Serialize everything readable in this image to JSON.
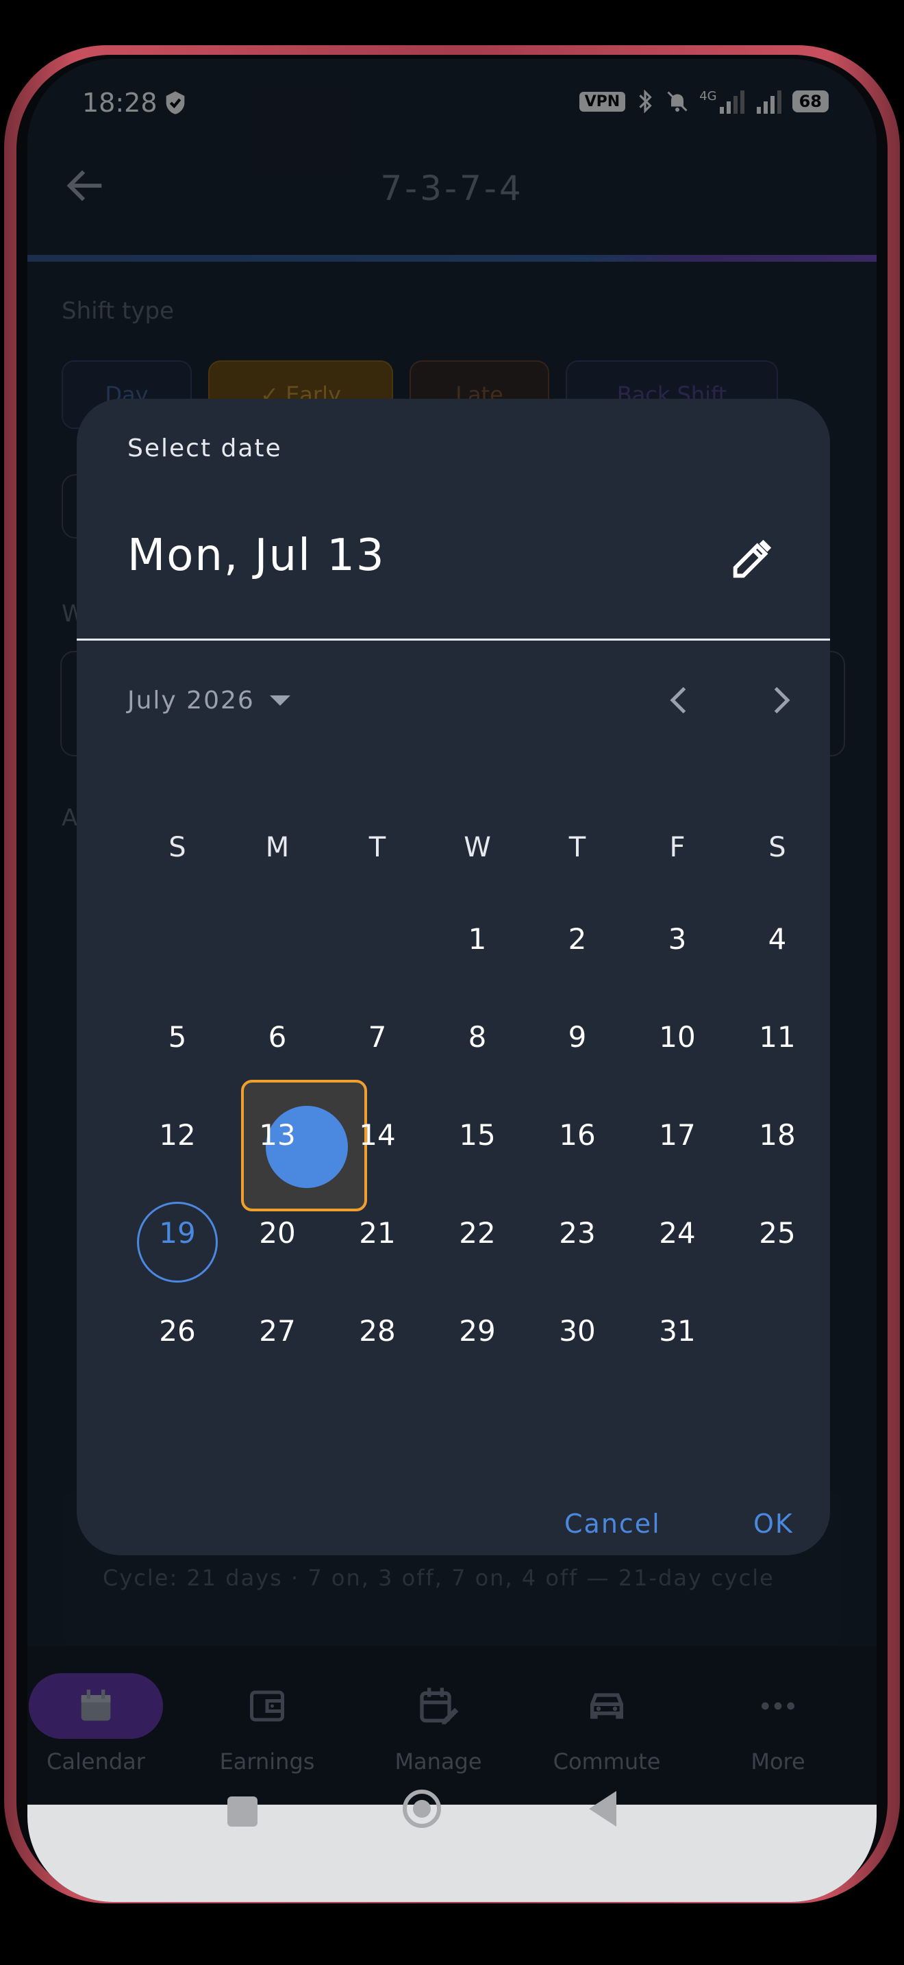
{
  "status_bar": {
    "time": "18:28",
    "vpn": "VPN",
    "network": "4G",
    "battery": "68"
  },
  "header": {
    "title": "7-3-7-4"
  },
  "background": {
    "shift_type_label": "Shift type",
    "shift_chips": [
      "Day",
      "✓  Early",
      "Late",
      "Back Shift"
    ],
    "partial_label_w": "W",
    "partial_label_a": "A",
    "cycle_text": "Cycle: 21 days · 7 on, 3 off, 7 on, 4 off — 21-day cycle"
  },
  "dialog": {
    "label": "Select date",
    "selected_date": "Mon, Jul 13",
    "month_year": "July 2026",
    "weekdays": [
      "S",
      "M",
      "T",
      "W",
      "T",
      "F",
      "S"
    ],
    "weeks": [
      [
        "",
        "",
        "",
        "1",
        "2",
        "3",
        "4"
      ],
      [
        "5",
        "6",
        "7",
        "8",
        "9",
        "10",
        "11"
      ],
      [
        "12",
        "13",
        "14",
        "15",
        "16",
        "17",
        "18"
      ],
      [
        "19",
        "20",
        "21",
        "22",
        "23",
        "24",
        "25"
      ],
      [
        "26",
        "27",
        "28",
        "29",
        "30",
        "31",
        ""
      ]
    ],
    "selected_day": "13",
    "today": "19",
    "cancel_label": "Cancel",
    "ok_label": "OK"
  },
  "nav": {
    "items": [
      {
        "label": "Calendar",
        "icon": "calendar-icon",
        "active": true
      },
      {
        "label": "Earnings",
        "icon": "wallet-icon",
        "active": false
      },
      {
        "label": "Manage",
        "icon": "edit-calendar-icon",
        "active": false
      },
      {
        "label": "Commute",
        "icon": "car-icon",
        "active": false
      },
      {
        "label": "More",
        "icon": "more-icon",
        "active": false
      }
    ]
  },
  "colors": {
    "accent": "#4b88e0",
    "selection_border": "#f0a02f",
    "nav_active": "#6331a8",
    "dialog_bg": "#222a37"
  }
}
